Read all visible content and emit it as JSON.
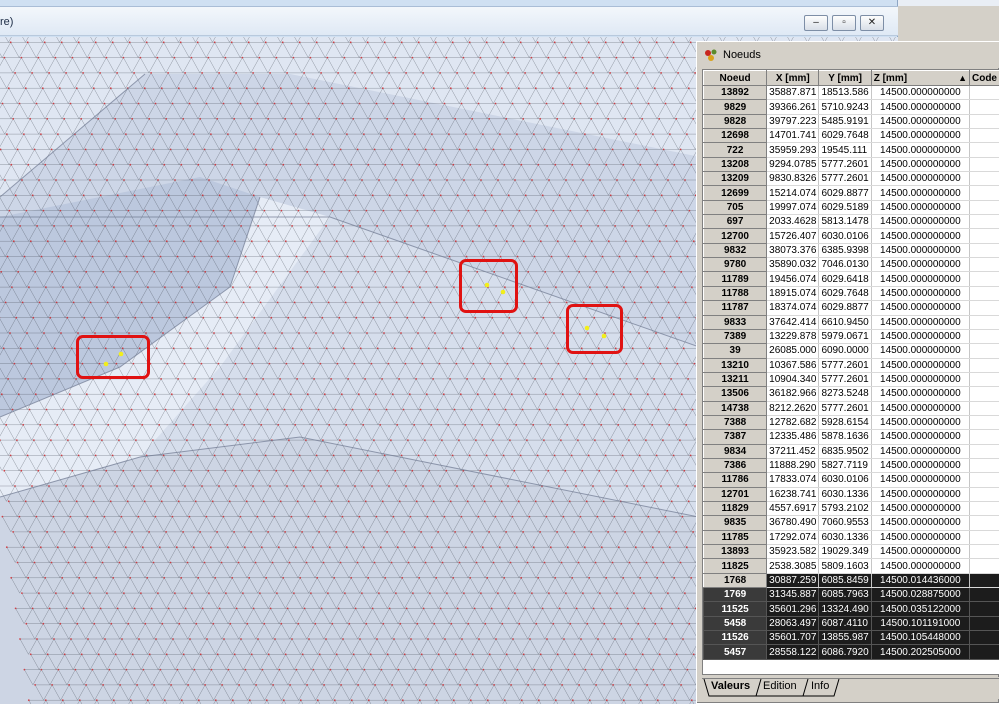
{
  "viewer": {
    "title_fragment": "re)"
  },
  "nodes_window": {
    "title": "Noeuds",
    "columns": [
      "Noeud",
      "X [mm]",
      "Y [mm]",
      "Z [mm]",
      "Code"
    ],
    "sort_indicator": "▲",
    "rows": [
      {
        "noeud": "13892",
        "x": "35887.871",
        "y": "18513.586",
        "z": "14500.000000000"
      },
      {
        "noeud": "9829",
        "x": "39366.261",
        "y": "5710.9243",
        "z": "14500.000000000"
      },
      {
        "noeud": "9828",
        "x": "39797.223",
        "y": "5485.9191",
        "z": "14500.000000000"
      },
      {
        "noeud": "12698",
        "x": "14701.741",
        "y": "6029.7648",
        "z": "14500.000000000"
      },
      {
        "noeud": "722",
        "x": "35959.293",
        "y": "19545.111",
        "z": "14500.000000000"
      },
      {
        "noeud": "13208",
        "x": "9294.0785",
        "y": "5777.2601",
        "z": "14500.000000000"
      },
      {
        "noeud": "13209",
        "x": "9830.8326",
        "y": "5777.2601",
        "z": "14500.000000000"
      },
      {
        "noeud": "12699",
        "x": "15214.074",
        "y": "6029.8877",
        "z": "14500.000000000"
      },
      {
        "noeud": "705",
        "x": "19997.074",
        "y": "6029.5189",
        "z": "14500.000000000"
      },
      {
        "noeud": "697",
        "x": "2033.4628",
        "y": "5813.1478",
        "z": "14500.000000000"
      },
      {
        "noeud": "12700",
        "x": "15726.407",
        "y": "6030.0106",
        "z": "14500.000000000"
      },
      {
        "noeud": "9832",
        "x": "38073.376",
        "y": "6385.9398",
        "z": "14500.000000000"
      },
      {
        "noeud": "9780",
        "x": "35890.032",
        "y": "7046.0130",
        "z": "14500.000000000"
      },
      {
        "noeud": "11789",
        "x": "19456.074",
        "y": "6029.6418",
        "z": "14500.000000000"
      },
      {
        "noeud": "11788",
        "x": "18915.074",
        "y": "6029.7648",
        "z": "14500.000000000"
      },
      {
        "noeud": "11787",
        "x": "18374.074",
        "y": "6029.8877",
        "z": "14500.000000000"
      },
      {
        "noeud": "9833",
        "x": "37642.414",
        "y": "6610.9450",
        "z": "14500.000000000"
      },
      {
        "noeud": "7389",
        "x": "13229.878",
        "y": "5979.0671",
        "z": "14500.000000000"
      },
      {
        "noeud": "39",
        "x": "26085.000",
        "y": "6090.0000",
        "z": "14500.000000000"
      },
      {
        "noeud": "13210",
        "x": "10367.586",
        "y": "5777.2601",
        "z": "14500.000000000"
      },
      {
        "noeud": "13211",
        "x": "10904.340",
        "y": "5777.2601",
        "z": "14500.000000000"
      },
      {
        "noeud": "13506",
        "x": "36182.966",
        "y": "8273.5248",
        "z": "14500.000000000"
      },
      {
        "noeud": "14738",
        "x": "8212.2620",
        "y": "5777.2601",
        "z": "14500.000000000"
      },
      {
        "noeud": "7388",
        "x": "12782.682",
        "y": "5928.6154",
        "z": "14500.000000000"
      },
      {
        "noeud": "7387",
        "x": "12335.486",
        "y": "5878.1636",
        "z": "14500.000000000"
      },
      {
        "noeud": "9834",
        "x": "37211.452",
        "y": "6835.9502",
        "z": "14500.000000000"
      },
      {
        "noeud": "7386",
        "x": "11888.290",
        "y": "5827.7119",
        "z": "14500.000000000"
      },
      {
        "noeud": "11786",
        "x": "17833.074",
        "y": "6030.0106",
        "z": "14500.000000000"
      },
      {
        "noeud": "12701",
        "x": "16238.741",
        "y": "6030.1336",
        "z": "14500.000000000"
      },
      {
        "noeud": "11829",
        "x": "4557.6917",
        "y": "5793.2102",
        "z": "14500.000000000"
      },
      {
        "noeud": "9835",
        "x": "36780.490",
        "y": "7060.9553",
        "z": "14500.000000000"
      },
      {
        "noeud": "11785",
        "x": "17292.074",
        "y": "6030.1336",
        "z": "14500.000000000"
      },
      {
        "noeud": "13893",
        "x": "35923.582",
        "y": "19029.349",
        "z": "14500.000000000"
      },
      {
        "noeud": "11825",
        "x": "2538.3085",
        "y": "5809.1603",
        "z": "14500.000000000"
      },
      {
        "noeud": "1768",
        "x": "30887.259",
        "y": "6085.8459",
        "z": "14500.014436000",
        "state": "cur"
      },
      {
        "noeud": "1769",
        "x": "31345.887",
        "y": "6085.7963",
        "z": "14500.028875000",
        "state": "sel"
      },
      {
        "noeud": "11525",
        "x": "35601.296",
        "y": "13324.490",
        "z": "14500.035122000",
        "state": "sel"
      },
      {
        "noeud": "5458",
        "x": "28063.497",
        "y": "6087.4110",
        "z": "14500.101191000",
        "state": "sel"
      },
      {
        "noeud": "11526",
        "x": "35601.707",
        "y": "13855.987",
        "z": "14500.105448000",
        "state": "sel"
      },
      {
        "noeud": "5457",
        "x": "28558.122",
        "y": "6086.7920",
        "z": "14500.202505000",
        "state": "sel"
      }
    ],
    "tabs": [
      "Valeurs",
      "Edition",
      "Info"
    ]
  },
  "colors": {
    "highlight": "#e01212",
    "mesh_fill": "#c8d2e4",
    "mesh_edge": "#3a3f4a",
    "mesh_node": "#d4262a"
  }
}
